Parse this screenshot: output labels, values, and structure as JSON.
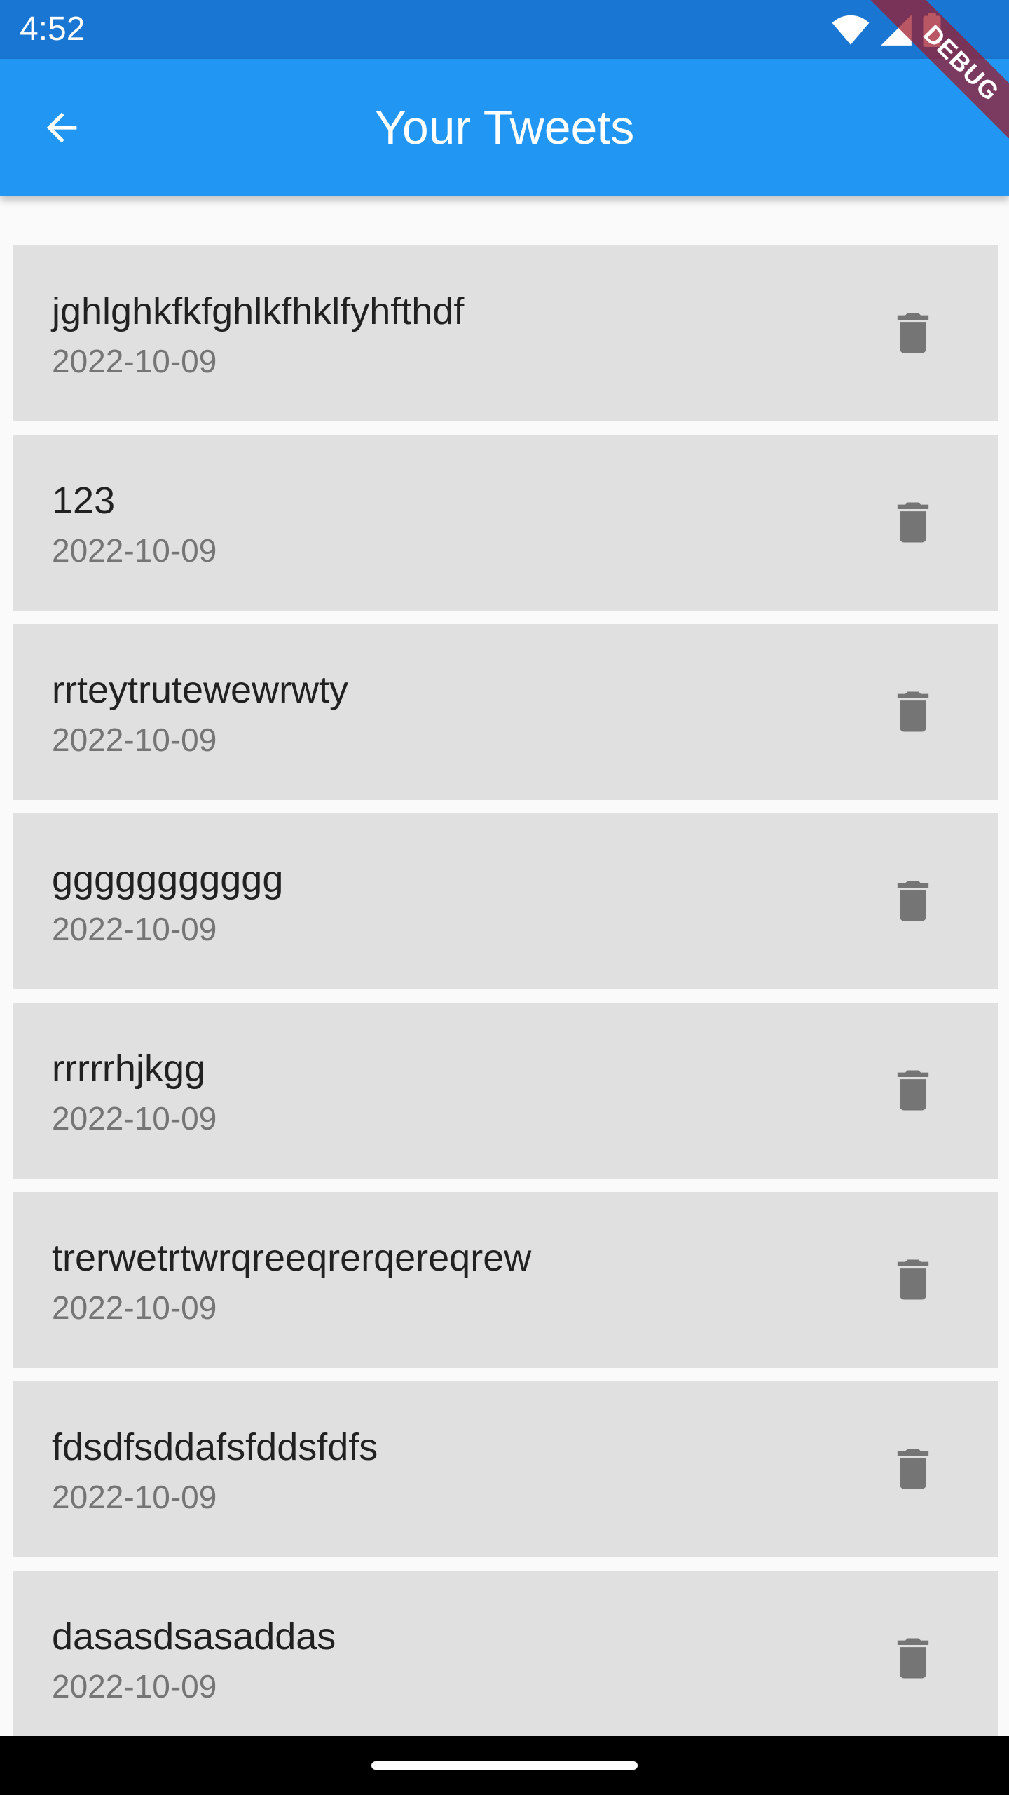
{
  "status_bar": {
    "time": "4:52",
    "icons": [
      "wifi-icon",
      "signal-icon",
      "battery-icon"
    ]
  },
  "debug_banner": "DEBUG",
  "app_bar": {
    "title": "Your Tweets",
    "back_icon": "arrow-back-icon",
    "background": "#2196f3"
  },
  "tweets": [
    {
      "text": "jghlghkfkfghlkfhklfyhfthdf",
      "date": "2022-10-09"
    },
    {
      "text": "123",
      "date": "2022-10-09"
    },
    {
      "text": "rrteytrutewewrwty",
      "date": "2022-10-09"
    },
    {
      "text": "ggggggggggg",
      "date": "2022-10-09"
    },
    {
      "text": "rrrrrhjkgg",
      "date": "2022-10-09"
    },
    {
      "text": "trerwetrtwrqreeqrerqereqrew",
      "date": "2022-10-09"
    },
    {
      "text": "fdsdfsddafsfddsfdfs",
      "date": "2022-10-09"
    },
    {
      "text": "dasasdsasaddas",
      "date": "2022-10-09"
    }
  ],
  "item_action_icon": "delete-icon"
}
